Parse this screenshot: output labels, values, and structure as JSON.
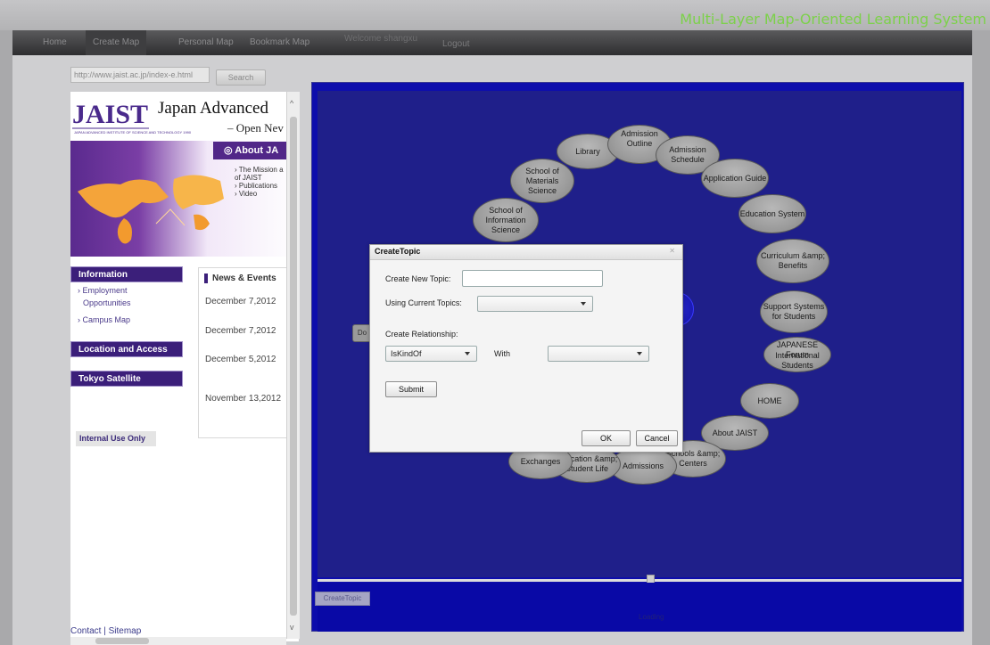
{
  "app_title": "Multi-Layer Map-Oriented Learning System",
  "nav": {
    "items": [
      "Home",
      "Create Map",
      "Personal Map",
      "Bookmark Map"
    ],
    "welcome": "Welcome shangxu",
    "logout": "Logout"
  },
  "url_bar": {
    "value": "http://www.jaist.ac.jp/index-e.html",
    "search_label": "Search"
  },
  "web_page": {
    "title": "Japan Advanced",
    "subtitle": "– Open Nev",
    "about_tab": "About JA",
    "about_links": [
      "› The Mission a",
      "of JAIST",
      "› Publications",
      "› Video"
    ],
    "logo_text": "JAIST",
    "logo_small": [
      "JAPAN",
      "ADVANCED INSTITUTE OF",
      "SCIENCE AND TECHNOLOGY",
      "1990"
    ],
    "information_label": "Information",
    "information_links": [
      "› Employment",
      "Opportunities",
      "› Campus Map"
    ],
    "location_label": "Location and Access",
    "tokyo_label": "Tokyo Satellite",
    "internal_label": "Internal Use Only",
    "news_heading": "News & Events",
    "news_dates": [
      "December 7,2012",
      "December 7,2012",
      "December 5,2012",
      "November 13,2012"
    ],
    "contact": "Contact | Sitemap"
  },
  "map": {
    "nodes": [
      "Library",
      "Admission Outline",
      "Admission Schedule",
      "Application Guide",
      "Education System",
      "Curriculum &amp; Benefits",
      "Support Systems for Students",
      "JAPANESE Forum",
      "International Students",
      "HOME",
      "About JAIST",
      "Schools &amp; Centers",
      "Admissions",
      "Education &amp; Student Life",
      "Exchanges",
      "School of Information Science",
      "School of Materials Science"
    ],
    "left_stub": "Do",
    "create_topic_button": "CreateTopic",
    "bottom_text": "Loading"
  },
  "dialog": {
    "title": "CreateTopic",
    "new_topic_label": "Create New Topic:",
    "new_topic_value": "",
    "current_topics_label": "Using Current Topics:",
    "current_topics_value": "",
    "relationship_label": "Create Relationship:",
    "relationship_value": "IsKindOf",
    "with_label": "With",
    "with_value": "",
    "submit": "Submit",
    "ok": "OK",
    "cancel": "Cancel"
  }
}
